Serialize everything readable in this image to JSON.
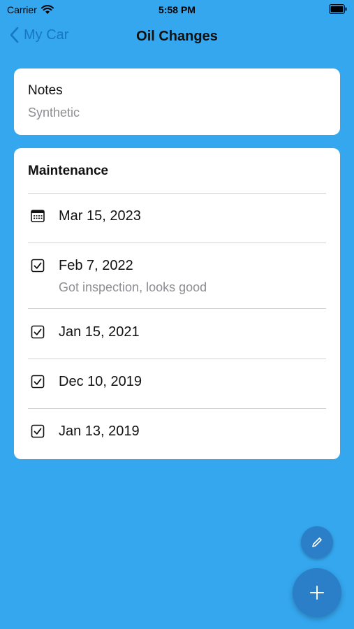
{
  "status_bar": {
    "carrier": "Carrier",
    "time": "5:58 PM"
  },
  "nav": {
    "back_label": "My Car",
    "title": "Oil Changes"
  },
  "notes": {
    "title": "Notes",
    "value": "Synthetic"
  },
  "maintenance": {
    "title": "Maintenance",
    "entries": [
      {
        "icon": "calendar-icon",
        "date": "Mar 15, 2023",
        "note": ""
      },
      {
        "icon": "checkbox-checked-icon",
        "date": "Feb 7, 2022",
        "note": "Got inspection, looks good"
      },
      {
        "icon": "checkbox-checked-icon",
        "date": "Jan 15, 2021",
        "note": ""
      },
      {
        "icon": "checkbox-checked-icon",
        "date": "Dec 10, 2019",
        "note": ""
      },
      {
        "icon": "checkbox-checked-icon",
        "date": "Jan 13, 2019",
        "note": ""
      }
    ]
  },
  "colors": {
    "background": "#35a7ef",
    "accent": "#1677c4",
    "fab": "#2b7fc8",
    "secondary_text": "#8e8e93"
  },
  "fabs": {
    "edit_icon": "pencil-icon",
    "add_icon": "plus-icon"
  }
}
